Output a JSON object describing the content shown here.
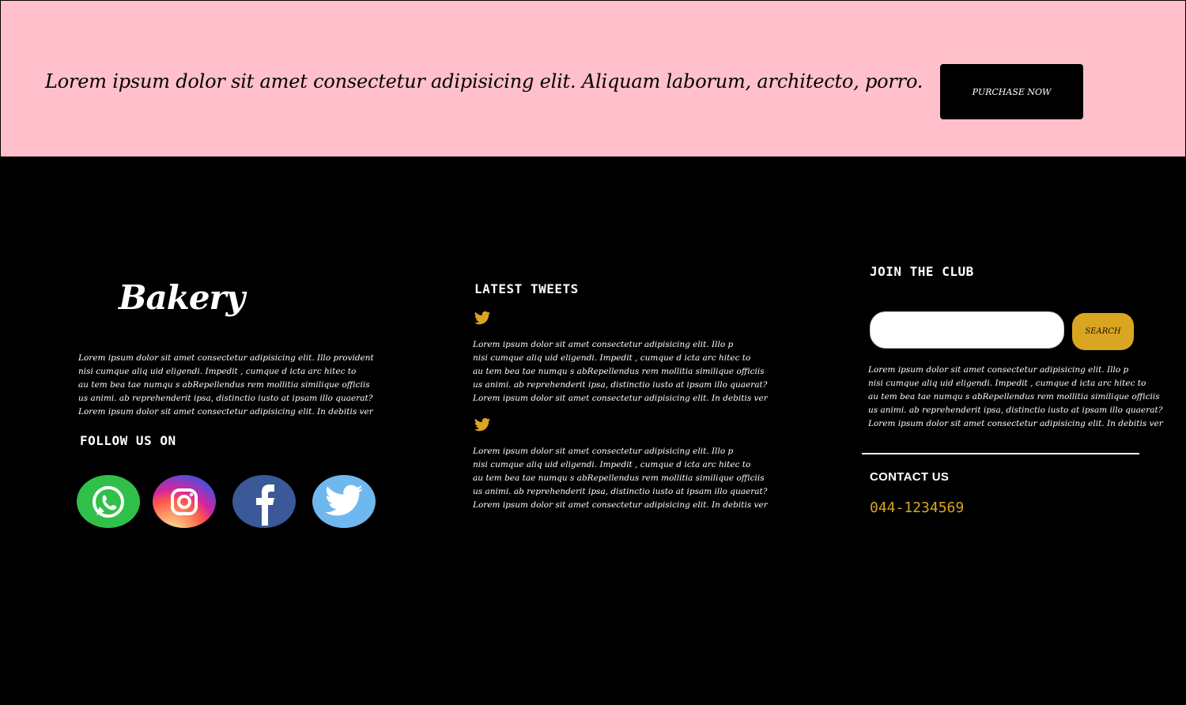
{
  "banner": {
    "text": "Lorem ipsum dolor sit amet consectetur adipisicing elit. Aliquam laborum, architecto, porro.",
    "button_label": "PURCHASE NOW"
  },
  "about": {
    "logo": "Bakery",
    "paragraph": [
      "Lorem ipsum dolor sit amet consectetur adipisicing elit. Illo provident",
      "nisi cumque aliq uid eligendi. Impedit , cumque d icta arc hitec to",
      "au tem bea tae numqu s abRepellendus rem mollitia similique officiis",
      "us animi. ab reprehenderit ipsa, distinctio iusto at  ipsam illo quaerat?",
      "Lorem ipsum dolor sit amet consectetur adipisicing elit. In debitis ver"
    ],
    "follow_heading": "FOLLOW US ON",
    "social": [
      {
        "name": "whatsapp-icon",
        "color": "#30c04a"
      },
      {
        "name": "instagram-icon",
        "color": "#d62976"
      },
      {
        "name": "facebook-icon",
        "color": "#3b5998"
      },
      {
        "name": "twitter-icon",
        "color": "#6fb8ef"
      }
    ]
  },
  "tweets": {
    "heading": "LATEST TWEETS",
    "icon_color": "#daa520",
    "items": [
      {
        "lines": [
          "Lorem ipsum dolor sit amet consectetur adipisicing elit. Illo p",
          "nisi cumque aliq uid eligendi. Impedit , cumque d icta arc hitec to",
          "au tem bea tae numqu s abRepellendus rem mollitia similique officiis",
          "us animi. ab reprehenderit ipsa, distinctio iusto at  ipsam illo quaerat?",
          "Lorem ipsum dolor sit amet consectetur adipisicing elit. In debitis ver"
        ]
      },
      {
        "lines": [
          "Lorem ipsum dolor sit amet consectetur adipisicing elit. Illo p",
          "nisi cumque aliq uid eligendi. Impedit , cumque d icta arc hitec to",
          "au tem bea tae numqu s abRepellendus rem mollitia similique officiis",
          "us animi. ab reprehenderit ipsa, distinctio iusto at  ipsam illo quaerat?",
          "Lorem ipsum dolor sit amet consectetur adipisicing elit. In debitis ver"
        ]
      }
    ]
  },
  "club": {
    "heading": "JOIN THE CLUB",
    "search_value": "",
    "search_button": "SEARCH",
    "paragraph": [
      "Lorem ipsum dolor sit amet consectetur adipisicing elit. Illo p",
      "nisi cumque aliq uid eligendi. Impedit , cumque d icta arc hitec to",
      "au tem bea tae numqu s abRepellendus rem mollitia similique officiis",
      "us animi. ab reprehenderit ipsa, distinctio iusto at  ipsam illo quaerat?",
      "Lorem ipsum dolor sit amet consectetur adipisicing elit. In debitis ver"
    ],
    "contact_heading": "CONTACT US",
    "phone": "044-1234569",
    "accent_color": "#daa520"
  }
}
